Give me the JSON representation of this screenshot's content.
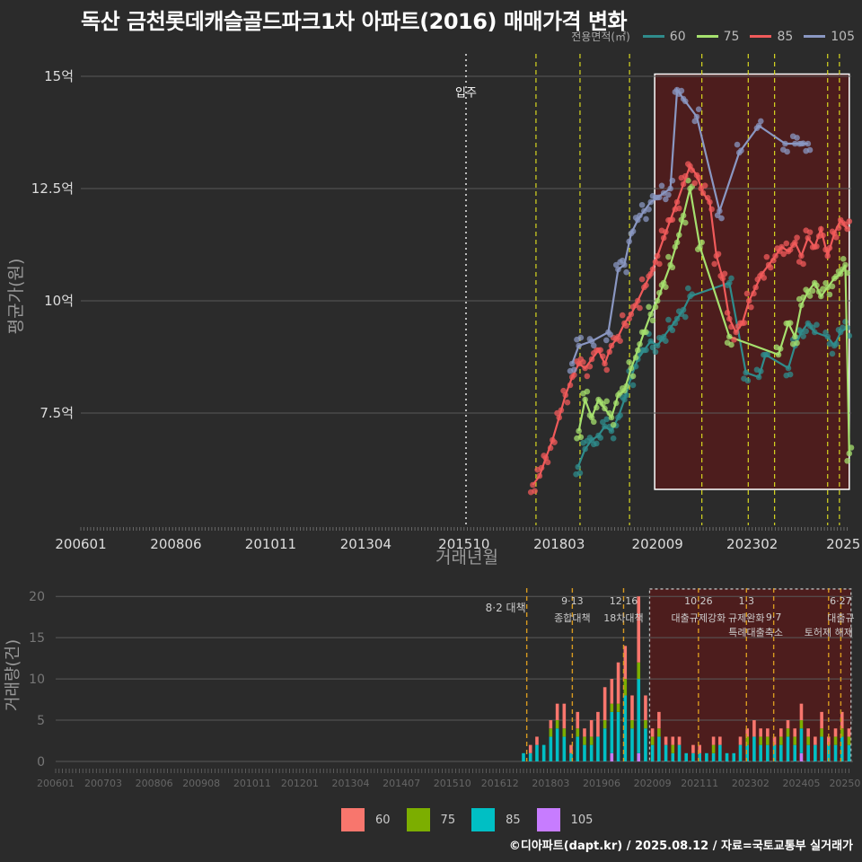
{
  "title": "독산 금천롯데캐슬골드파크1차 아파트(2016) 매매가격 변화",
  "footer": "©디아파트(dapt.kr) / 2025.08.12 / 자료=국토교통부 실거래가",
  "colors": {
    "background": "#2b2b2b",
    "grid": "#5a5a5a",
    "policy_line": "#d8d820",
    "policy_line_bottom": "#d89a20",
    "highlight_border": "#ffffff",
    "highlight_fill": "#5a1a1a",
    "s60": "#2f8c8c",
    "s75": "#a6e06e",
    "s85": "#f05a5a",
    "s105": "#8a97c2",
    "b60": "#f8766d",
    "b75": "#7cae00",
    "b85": "#00bfc4",
    "b105": "#c77cff"
  },
  "legend_top": {
    "title": "전용면적(㎡)",
    "items": [
      "60",
      "75",
      "85",
      "105"
    ]
  },
  "legend_bottom": {
    "items": [
      "60",
      "75",
      "85",
      "105"
    ]
  },
  "chart_data": [
    {
      "type": "line",
      "title": "독산 금천롯데캐슬골드파크1차 아파트(2016) 매매가격 변화",
      "xlabel": "거래년월",
      "ylabel": "평균가(원)",
      "x_tick_labels": [
        "200601",
        "200806",
        "201011",
        "201304",
        "201510",
        "201803",
        "202009",
        "202302",
        "2025"
      ],
      "y_tick_labels": [
        "7.5억",
        "10억",
        "12.5억",
        "15억"
      ],
      "y_ticks": [
        7.5,
        10,
        12.5,
        15
      ],
      "ylim": [
        5.0,
        15.5
      ],
      "xlim": [
        2006.0,
        2025.6
      ],
      "grid": true,
      "legend_position": "top-right",
      "annotation_moveIn": {
        "label": "입주",
        "x": 2015.8
      },
      "policy_lines_x": [
        2017.58,
        2018.7,
        2019.96,
        2021.8,
        2022.98,
        2023.65,
        2025.0,
        2025.3
      ],
      "highlight_box": {
        "x_from": 2020.6,
        "x_to": 2025.55,
        "y_from": 5.8,
        "y_to": 15.05
      },
      "series": [
        {
          "name": "60",
          "x": [
            2018.65,
            2018.83,
            2019.0,
            2019.17,
            2019.33,
            2019.5,
            2019.67,
            2019.83,
            2020.0,
            2020.17,
            2020.33,
            2020.5,
            2020.67,
            2020.83,
            2021.0,
            2021.17,
            2021.33,
            2021.5,
            2022.5,
            2022.92,
            2023.25,
            2023.42,
            2024.0,
            2024.17,
            2024.33,
            2024.5,
            2024.67,
            2025.0,
            2025.17,
            2025.33,
            2025.5
          ],
          "y": [
            6.3,
            6.7,
            6.9,
            7.0,
            7.2,
            7.1,
            7.4,
            7.8,
            8.3,
            8.7,
            8.9,
            9.1,
            9.0,
            9.2,
            9.4,
            9.6,
            9.8,
            10.1,
            10.4,
            8.4,
            8.3,
            8.8,
            8.5,
            9.0,
            9.3,
            9.5,
            9.3,
            9.2,
            9.0,
            9.3,
            9.4
          ]
        },
        {
          "name": "75",
          "x": [
            2018.67,
            2018.83,
            2019.0,
            2019.17,
            2019.33,
            2019.5,
            2019.67,
            2019.83,
            2020.0,
            2020.17,
            2020.33,
            2020.5,
            2020.67,
            2020.83,
            2021.0,
            2021.17,
            2021.33,
            2021.5,
            2021.75,
            2022.5,
            2023.75,
            2024.0,
            2024.17,
            2024.33,
            2024.5,
            2024.67,
            2024.83,
            2025.0,
            2025.17,
            2025.33,
            2025.45,
            2025.55
          ],
          "y": [
            7.1,
            7.8,
            7.4,
            7.8,
            7.6,
            7.4,
            7.9,
            8.0,
            8.5,
            8.9,
            9.3,
            9.7,
            10.0,
            10.4,
            10.8,
            11.3,
            11.9,
            12.5,
            11.2,
            9.2,
            8.8,
            9.5,
            9.2,
            9.9,
            10.2,
            10.4,
            10.1,
            10.3,
            10.5,
            10.6,
            10.8,
            6.6
          ]
        },
        {
          "name": "85",
          "x": [
            2017.5,
            2017.67,
            2017.83,
            2018.0,
            2018.17,
            2018.33,
            2018.5,
            2018.67,
            2018.83,
            2019.0,
            2019.17,
            2019.33,
            2019.5,
            2019.67,
            2019.83,
            2020.0,
            2020.17,
            2020.33,
            2020.5,
            2020.67,
            2020.83,
            2021.0,
            2021.17,
            2021.33,
            2021.5,
            2021.67,
            2021.83,
            2022.0,
            2022.17,
            2022.33,
            2022.5,
            2022.67,
            2022.83,
            2023.0,
            2023.17,
            2023.33,
            2023.5,
            2023.67,
            2023.83,
            2024.0,
            2024.17,
            2024.33,
            2024.5,
            2024.67,
            2024.83,
            2025.0,
            2025.17,
            2025.33,
            2025.5
          ],
          "y": [
            5.9,
            6.1,
            6.5,
            6.9,
            7.4,
            7.9,
            8.3,
            8.6,
            8.5,
            8.7,
            8.9,
            8.6,
            9.0,
            9.2,
            9.5,
            9.7,
            10.0,
            10.3,
            10.6,
            11.0,
            11.4,
            11.8,
            12.2,
            12.6,
            13.0,
            12.8,
            12.4,
            12.2,
            11.0,
            10.5,
            9.6,
            9.3,
            9.5,
            10.0,
            10.3,
            10.6,
            10.8,
            11.0,
            11.2,
            11.1,
            11.3,
            11.0,
            11.4,
            11.2,
            11.6,
            11.0,
            11.5,
            11.8,
            11.6
          ]
        },
        {
          "name": "105",
          "x": [
            2018.5,
            2018.67,
            2019.0,
            2019.42,
            2019.67,
            2019.83,
            2020.0,
            2020.17,
            2020.33,
            2020.5,
            2020.67,
            2020.83,
            2021.0,
            2021.17,
            2021.33,
            2021.67,
            2022.25,
            2022.75,
            2023.25,
            2023.92,
            2024.17,
            2024.33,
            2024.5
          ],
          "y": [
            8.6,
            9.0,
            9.1,
            9.3,
            10.7,
            10.8,
            11.5,
            11.8,
            12.0,
            12.2,
            12.3,
            12.4,
            12.5,
            14.7,
            14.5,
            14.1,
            12.0,
            13.3,
            13.9,
            13.5,
            13.5,
            13.5,
            13.5
          ]
        }
      ]
    },
    {
      "type": "bar",
      "ylabel": "거래량(건)",
      "y_tick_labels": [
        "0",
        "5",
        "10",
        "15",
        "20"
      ],
      "y_ticks": [
        0,
        5,
        10,
        15,
        20
      ],
      "ylim": [
        0,
        21
      ],
      "xlim": [
        2006.0,
        2025.6
      ],
      "x_tick_labels": [
        "200601",
        "200703",
        "200806",
        "200908",
        "201011",
        "201201",
        "201304",
        "201407",
        "201510",
        "201612",
        "201803",
        "201906",
        "202009",
        "202111",
        "202302",
        "202405",
        "20250"
      ],
      "grid": true,
      "stacked": true,
      "policy_events": [
        {
          "date": "8·2",
          "label": "대책",
          "x": 2017.58
        },
        {
          "date": "9·13",
          "label": "종합대책",
          "x": 2018.7
        },
        {
          "date": "12·16",
          "label": "18차대책",
          "x": 2019.96
        },
        {
          "date": "10·26",
          "label": "대출규제강화",
          "x": 2021.8
        },
        {
          "date": "1·3",
          "label": "규제완화",
          "x": 2022.98
        },
        {
          "date": "9·7",
          "label": "특례대출축소",
          "x": 2023.65
        },
        {
          "date": "",
          "label": "토허제 해제",
          "x": 2025.0
        },
        {
          "date": "6·27",
          "label": "대출규",
          "x": 2025.3
        }
      ],
      "highlight_box": {
        "x_from": 2020.6,
        "x_to": 2025.55
      },
      "x": [
        2017.5,
        2017.67,
        2017.83,
        2018.0,
        2018.17,
        2018.33,
        2018.5,
        2018.67,
        2018.83,
        2019.0,
        2019.17,
        2019.33,
        2019.5,
        2019.67,
        2019.83,
        2020.0,
        2020.17,
        2020.33,
        2020.5,
        2020.67,
        2020.83,
        2021.0,
        2021.17,
        2021.33,
        2021.5,
        2021.67,
        2021.83,
        2022.0,
        2022.17,
        2022.33,
        2022.5,
        2022.67,
        2022.83,
        2023.0,
        2023.17,
        2023.33,
        2023.5,
        2023.67,
        2023.83,
        2024.0,
        2024.17,
        2024.33,
        2024.5,
        2024.67,
        2024.83,
        2025.0,
        2025.17,
        2025.33,
        2025.5
      ],
      "series": [
        {
          "name": "60",
          "values": [
            0,
            1,
            1,
            0,
            1,
            2,
            3,
            1,
            2,
            1,
            2,
            3,
            4,
            3,
            5,
            4,
            3,
            8,
            3,
            1,
            2,
            1,
            1,
            1,
            0,
            1,
            1,
            0,
            1,
            1,
            0,
            0,
            1,
            1,
            2,
            1,
            1,
            1,
            1,
            1,
            1,
            2,
            1,
            1,
            2,
            1,
            1,
            2,
            1
          ]
        },
        {
          "name": "75",
          "values": [
            0,
            0,
            0,
            0,
            1,
            1,
            1,
            0,
            1,
            1,
            1,
            0,
            1,
            1,
            1,
            2,
            1,
            2,
            1,
            1,
            1,
            0,
            1,
            0,
            0,
            0,
            0,
            0,
            1,
            0,
            0,
            0,
            0,
            1,
            0,
            1,
            1,
            0,
            1,
            1,
            1,
            1,
            1,
            0,
            1,
            0,
            1,
            1,
            1
          ]
        },
        {
          "name": "85",
          "values": [
            1,
            1,
            2,
            2,
            3,
            4,
            3,
            1,
            3,
            2,
            2,
            3,
            4,
            5,
            6,
            8,
            4,
            9,
            4,
            2,
            3,
            2,
            1,
            2,
            1,
            1,
            1,
            1,
            1,
            2,
            1,
            1,
            2,
            2,
            3,
            2,
            2,
            2,
            2,
            3,
            2,
            3,
            2,
            2,
            3,
            2,
            2,
            3,
            2
          ]
        },
        {
          "name": "105",
          "values": [
            0,
            0,
            0,
            0,
            0,
            0,
            0,
            0,
            0,
            0,
            0,
            0,
            0,
            1,
            0,
            0,
            0,
            1,
            0,
            0,
            0,
            0,
            0,
            0,
            0,
            0,
            0,
            0,
            0,
            0,
            0,
            0,
            0,
            0,
            0,
            0,
            0,
            0,
            0,
            0,
            0,
            1,
            0,
            0,
            0,
            0,
            0,
            0,
            0
          ]
        }
      ]
    }
  ]
}
